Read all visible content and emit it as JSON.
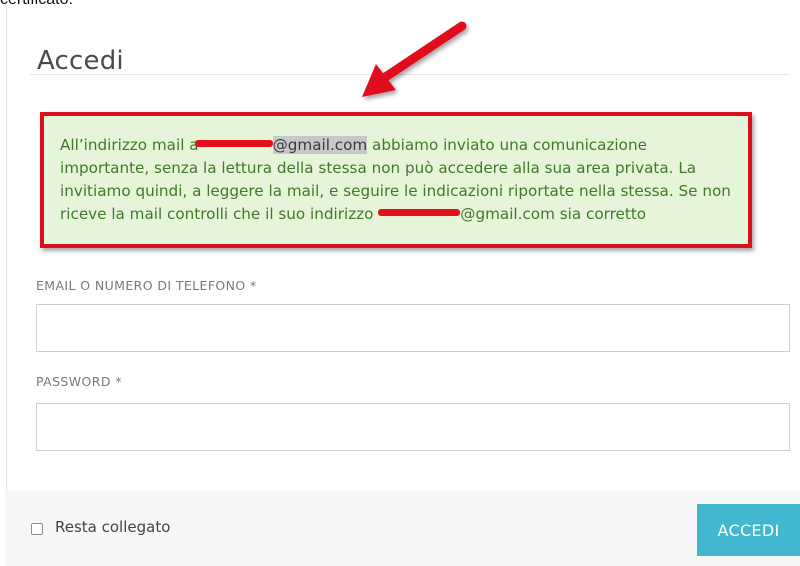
{
  "top_caption": "certificato.",
  "login": {
    "title": "Accedi",
    "alert": {
      "part1": "All’indirizzo mail a",
      "email1_domain": "@gmail.com",
      "part2": " abbiamo inviato una comunicazione importante, senza la lettura della stessa non può accedere alla sua area privata. La invitiamo quindi, a leggere la mail, e seguire le indicazioni riportate nella stessa. Se non riceve la mail controlli che il suo indirizzo ",
      "email2_domain": "@gmail.com",
      "part3": " sia corretto"
    },
    "email_label": "EMAIL O NUMERO DI TELEFONO *",
    "email_value": "",
    "password_label": "PASSWORD *",
    "password_value": "",
    "remember_label": "Resta collegato",
    "submit_label": "ACCEDI"
  },
  "annotations": {
    "arrow_color": "#e0111b",
    "highlight_border_color": "#d8101a",
    "redaction_color": "#e0111b"
  },
  "colors": {
    "alert_bg": "#e6f5d9",
    "alert_text": "#3f7a2a",
    "button_bg": "#41b8cf"
  }
}
